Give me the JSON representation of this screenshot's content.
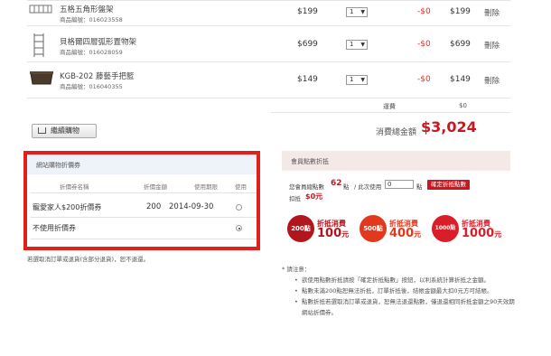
{
  "cart": {
    "items": [
      {
        "name": "五格五角形盤架",
        "code": "商品編號：016023558",
        "price": "$199",
        "qty": "1",
        "discount": "-$0",
        "subtotal": "$199",
        "delete": "刪除"
      },
      {
        "name": "貝格爾四層弧形置物架",
        "code": "商品編號：016028059",
        "price": "$699",
        "qty": "1",
        "discount": "-$0",
        "subtotal": "$699",
        "delete": "刪除"
      },
      {
        "name": "KGB-202 藤藝手把籃",
        "code": "商品編號：016040355",
        "price": "$149",
        "qty": "1",
        "discount": "-$0",
        "subtotal": "$149",
        "delete": "刪除"
      }
    ],
    "shipping_label": "運費",
    "shipping_value": "$0",
    "total_label": "消費總金額",
    "total_value": "$3,024",
    "continue_label": "繼續購物"
  },
  "coupon": {
    "title": "網站購物折價券",
    "col_name": "折價券名稱",
    "col_amount": "折價金額",
    "col_expiry": "使用期限",
    "col_use": "使用",
    "row_name": "寵愛家人$200折價券",
    "row_amount": "200",
    "row_expiry": "2014-09-30",
    "none_label": "不使用折價券",
    "selected": "none"
  },
  "partial_note": "若選取消訂單或退貨(含部分退貨)，恕不退還。",
  "points": {
    "title": "會員點數折抵",
    "have_label": "您會員總點數",
    "have_value": "62",
    "point_unit": "點",
    "use_label": "/ 此次使用",
    "input_value": "0",
    "confirm_label": "確定折抵點數",
    "deduct_label": "扣抵",
    "deduct_value": "$0元",
    "badges": [
      {
        "pts": "200點",
        "line1": "折抵消費",
        "amount": "100",
        "unit": "元",
        "color": "#b0161c"
      },
      {
        "pts": "500點",
        "line1": "折抵消費",
        "amount": "400",
        "unit": "元",
        "color": "#e2381d"
      },
      {
        "pts": "1000點",
        "line1": "折抵消費",
        "amount": "1000",
        "unit": "元",
        "color": "#d91e2a"
      }
    ]
  },
  "notes": {
    "heading": "* 請注意：",
    "items": [
      "欲使用點數折抵請按「確定折抵點數」按鈕，以利系統計算折抵之金額。",
      "點數未滿200點恕無法折抵，訂單折抵後，結帳金額最大扣0元方可結帳。",
      "點數折抵若選取消訂單或退貨，恕無法退還點數，僅退還相同折抵金額之90天效期網站折價券。"
    ]
  }
}
